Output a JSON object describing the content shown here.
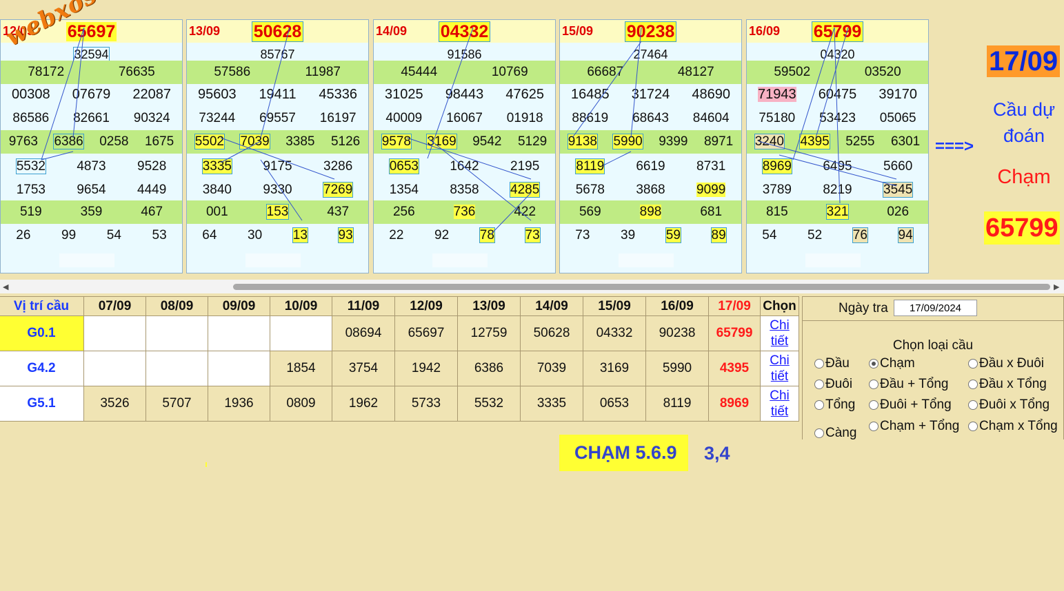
{
  "brand": {
    "logo_text": "webxoso.net"
  },
  "panels": [
    {
      "date": "12/09",
      "g0": "65697",
      "rows": [
        [
          "32594"
        ],
        [
          "78172",
          "76635"
        ],
        [
          "00308",
          "07679",
          "22087"
        ],
        [
          "86586",
          "82661",
          "90324"
        ],
        [
          "9763",
          "6386",
          "0258",
          "1675"
        ],
        [
          "5532",
          "4873",
          "9528"
        ],
        [
          "1753",
          "9654",
          "4449"
        ],
        [
          "519",
          "359",
          "467"
        ],
        [
          "26",
          "99",
          "54",
          "53"
        ]
      ]
    },
    {
      "date": "13/09",
      "g0": "50628",
      "rows": [
        [
          "85767"
        ],
        [
          "57586",
          "11987"
        ],
        [
          "95603",
          "19411",
          "45336"
        ],
        [
          "73244",
          "69557",
          "16197"
        ],
        [
          "5502",
          "7039",
          "3385",
          "5126"
        ],
        [
          "3335",
          "9175",
          "3286"
        ],
        [
          "3840",
          "9330",
          "7269"
        ],
        [
          "001",
          "153",
          "437"
        ],
        [
          "64",
          "30",
          "13",
          "93"
        ]
      ]
    },
    {
      "date": "14/09",
      "g0": "04332",
      "rows": [
        [
          "91586"
        ],
        [
          "45444",
          "10769"
        ],
        [
          "31025",
          "98443",
          "47625"
        ],
        [
          "40009",
          "16067",
          "01918"
        ],
        [
          "9578",
          "3169",
          "9542",
          "5129"
        ],
        [
          "0653",
          "1642",
          "2195"
        ],
        [
          "1354",
          "8358",
          "4285"
        ],
        [
          "256",
          "736",
          "422"
        ],
        [
          "22",
          "92",
          "78",
          "73"
        ]
      ]
    },
    {
      "date": "15/09",
      "g0": "90238",
      "rows": [
        [
          "27464"
        ],
        [
          "66687",
          "48127"
        ],
        [
          "16485",
          "31724",
          "48690"
        ],
        [
          "88619",
          "68643",
          "84604"
        ],
        [
          "9138",
          "5990",
          "9399",
          "8971"
        ],
        [
          "8119",
          "6619",
          "8731"
        ],
        [
          "5678",
          "3868",
          "9099"
        ],
        [
          "569",
          "898",
          "681"
        ],
        [
          "73",
          "39",
          "59",
          "89"
        ]
      ]
    },
    {
      "date": "16/09",
      "g0": "65799",
      "rows": [
        [
          "04320"
        ],
        [
          "59502",
          "03520"
        ],
        [
          "71943",
          "60475",
          "39170"
        ],
        [
          "75180",
          "53423",
          "05065"
        ],
        [
          "3240",
          "4395",
          "5255",
          "6301"
        ],
        [
          "8969",
          "6495",
          "5660"
        ],
        [
          "3789",
          "8219",
          "3545"
        ],
        [
          "815",
          "321",
          "026"
        ],
        [
          "54",
          "52",
          "76",
          "94"
        ]
      ]
    }
  ],
  "prediction": {
    "date": "17/09",
    "arrow": "===>",
    "label_line1": "Cầu dự",
    "label_line2": "đoán",
    "type": "Chạm",
    "value": "65799"
  },
  "table": {
    "headers": [
      "Vị trí cầu",
      "07/09",
      "08/09",
      "09/09",
      "10/09",
      "11/09",
      "12/09",
      "13/09",
      "14/09",
      "15/09",
      "16/09",
      "17/09",
      "Chọn"
    ],
    "rows": [
      {
        "name": "G0.1",
        "values": [
          "",
          "",
          "",
          "",
          "08694",
          "65697",
          "12759",
          "50628",
          "04332",
          "90238"
        ],
        "today": "65799",
        "link1": "Chi",
        "link2": "tiết"
      },
      {
        "name": "G4.2",
        "values": [
          "",
          "",
          "",
          "1854",
          "3754",
          "1942",
          "6386",
          "7039",
          "3169",
          "5990"
        ],
        "today": "4395",
        "link1": "Chi",
        "link2": "tiết"
      },
      {
        "name": "G5.1",
        "values": [
          "3526",
          "5707",
          "1936",
          "0809",
          "1962",
          "5733",
          "5532",
          "3335",
          "0653",
          "8119"
        ],
        "today": "8969",
        "link1": "Chi",
        "link2": "tiết"
      }
    ]
  },
  "sidebar": {
    "date_label": "Ngày tra",
    "date_value": "17/09/2024",
    "choose_label": "Chọn loại cầu",
    "options": [
      "Đầu",
      "Chạm",
      "Đầu x Đuôi",
      "Đuôi",
      "Đầu + Tổng",
      "Đầu x Tổng",
      "Tổng",
      "Đuôi + Tổng",
      "Đuôi x Tổng",
      "Càng",
      "Chạm + Tổng",
      "Chạm x Tổng"
    ],
    "selected": "Chạm"
  },
  "note": {
    "main": "CHẠM 5.6.9",
    "extra": "3,4"
  },
  "colors": {
    "background": "#efe3b2",
    "accent_red": "#e00000",
    "accent_blue": "#1a3aff",
    "highlight": "#ffff33"
  }
}
